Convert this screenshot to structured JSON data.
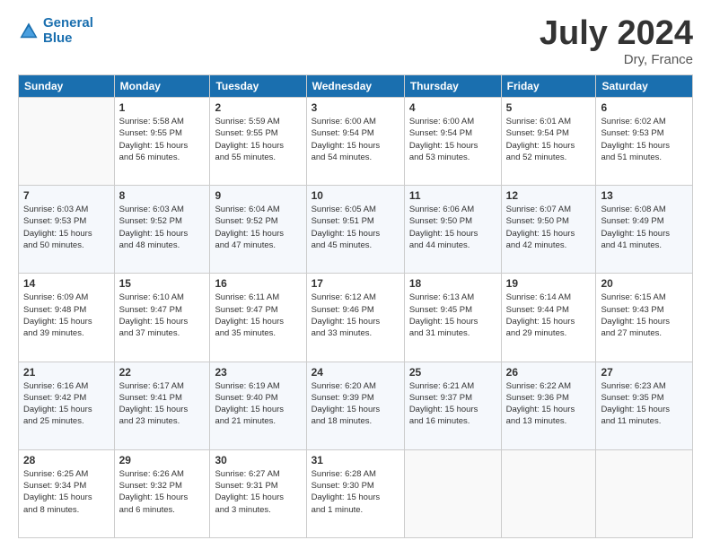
{
  "logo": {
    "line1": "General",
    "line2": "Blue"
  },
  "title": "July 2024",
  "location": "Dry, France",
  "days_of_week": [
    "Sunday",
    "Monday",
    "Tuesday",
    "Wednesday",
    "Thursday",
    "Friday",
    "Saturday"
  ],
  "weeks": [
    [
      {
        "day": "",
        "content": ""
      },
      {
        "day": "1",
        "content": "Sunrise: 5:58 AM\nSunset: 9:55 PM\nDaylight: 15 hours\nand 56 minutes."
      },
      {
        "day": "2",
        "content": "Sunrise: 5:59 AM\nSunset: 9:55 PM\nDaylight: 15 hours\nand 55 minutes."
      },
      {
        "day": "3",
        "content": "Sunrise: 6:00 AM\nSunset: 9:54 PM\nDaylight: 15 hours\nand 54 minutes."
      },
      {
        "day": "4",
        "content": "Sunrise: 6:00 AM\nSunset: 9:54 PM\nDaylight: 15 hours\nand 53 minutes."
      },
      {
        "day": "5",
        "content": "Sunrise: 6:01 AM\nSunset: 9:54 PM\nDaylight: 15 hours\nand 52 minutes."
      },
      {
        "day": "6",
        "content": "Sunrise: 6:02 AM\nSunset: 9:53 PM\nDaylight: 15 hours\nand 51 minutes."
      }
    ],
    [
      {
        "day": "7",
        "content": "Sunrise: 6:03 AM\nSunset: 9:53 PM\nDaylight: 15 hours\nand 50 minutes."
      },
      {
        "day": "8",
        "content": "Sunrise: 6:03 AM\nSunset: 9:52 PM\nDaylight: 15 hours\nand 48 minutes."
      },
      {
        "day": "9",
        "content": "Sunrise: 6:04 AM\nSunset: 9:52 PM\nDaylight: 15 hours\nand 47 minutes."
      },
      {
        "day": "10",
        "content": "Sunrise: 6:05 AM\nSunset: 9:51 PM\nDaylight: 15 hours\nand 45 minutes."
      },
      {
        "day": "11",
        "content": "Sunrise: 6:06 AM\nSunset: 9:50 PM\nDaylight: 15 hours\nand 44 minutes."
      },
      {
        "day": "12",
        "content": "Sunrise: 6:07 AM\nSunset: 9:50 PM\nDaylight: 15 hours\nand 42 minutes."
      },
      {
        "day": "13",
        "content": "Sunrise: 6:08 AM\nSunset: 9:49 PM\nDaylight: 15 hours\nand 41 minutes."
      }
    ],
    [
      {
        "day": "14",
        "content": "Sunrise: 6:09 AM\nSunset: 9:48 PM\nDaylight: 15 hours\nand 39 minutes."
      },
      {
        "day": "15",
        "content": "Sunrise: 6:10 AM\nSunset: 9:47 PM\nDaylight: 15 hours\nand 37 minutes."
      },
      {
        "day": "16",
        "content": "Sunrise: 6:11 AM\nSunset: 9:47 PM\nDaylight: 15 hours\nand 35 minutes."
      },
      {
        "day": "17",
        "content": "Sunrise: 6:12 AM\nSunset: 9:46 PM\nDaylight: 15 hours\nand 33 minutes."
      },
      {
        "day": "18",
        "content": "Sunrise: 6:13 AM\nSunset: 9:45 PM\nDaylight: 15 hours\nand 31 minutes."
      },
      {
        "day": "19",
        "content": "Sunrise: 6:14 AM\nSunset: 9:44 PM\nDaylight: 15 hours\nand 29 minutes."
      },
      {
        "day": "20",
        "content": "Sunrise: 6:15 AM\nSunset: 9:43 PM\nDaylight: 15 hours\nand 27 minutes."
      }
    ],
    [
      {
        "day": "21",
        "content": "Sunrise: 6:16 AM\nSunset: 9:42 PM\nDaylight: 15 hours\nand 25 minutes."
      },
      {
        "day": "22",
        "content": "Sunrise: 6:17 AM\nSunset: 9:41 PM\nDaylight: 15 hours\nand 23 minutes."
      },
      {
        "day": "23",
        "content": "Sunrise: 6:19 AM\nSunset: 9:40 PM\nDaylight: 15 hours\nand 21 minutes."
      },
      {
        "day": "24",
        "content": "Sunrise: 6:20 AM\nSunset: 9:39 PM\nDaylight: 15 hours\nand 18 minutes."
      },
      {
        "day": "25",
        "content": "Sunrise: 6:21 AM\nSunset: 9:37 PM\nDaylight: 15 hours\nand 16 minutes."
      },
      {
        "day": "26",
        "content": "Sunrise: 6:22 AM\nSunset: 9:36 PM\nDaylight: 15 hours\nand 13 minutes."
      },
      {
        "day": "27",
        "content": "Sunrise: 6:23 AM\nSunset: 9:35 PM\nDaylight: 15 hours\nand 11 minutes."
      }
    ],
    [
      {
        "day": "28",
        "content": "Sunrise: 6:25 AM\nSunset: 9:34 PM\nDaylight: 15 hours\nand 8 minutes."
      },
      {
        "day": "29",
        "content": "Sunrise: 6:26 AM\nSunset: 9:32 PM\nDaylight: 15 hours\nand 6 minutes."
      },
      {
        "day": "30",
        "content": "Sunrise: 6:27 AM\nSunset: 9:31 PM\nDaylight: 15 hours\nand 3 minutes."
      },
      {
        "day": "31",
        "content": "Sunrise: 6:28 AM\nSunset: 9:30 PM\nDaylight: 15 hours\nand 1 minute."
      },
      {
        "day": "",
        "content": ""
      },
      {
        "day": "",
        "content": ""
      },
      {
        "day": "",
        "content": ""
      }
    ]
  ]
}
